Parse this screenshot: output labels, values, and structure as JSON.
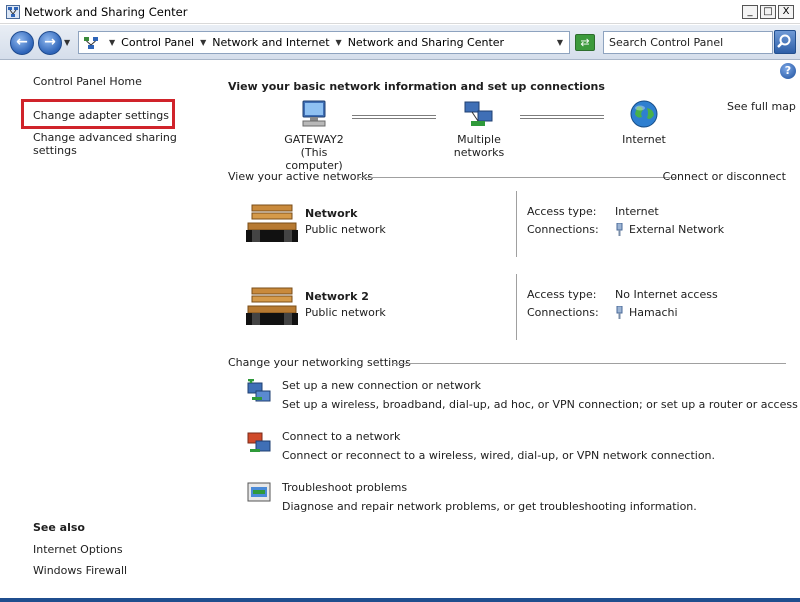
{
  "window": {
    "title": "Network and Sharing Center",
    "buttons": {
      "minimize": "_",
      "maximize": "□",
      "close": "X"
    }
  },
  "addressbar": {
    "crumbs": [
      "Control Panel",
      "Network and Internet",
      "Network and Sharing Center"
    ],
    "search_placeholder": "Search Control Panel"
  },
  "sidebar": {
    "home": "Control Panel Home",
    "links": [
      "Change adapter settings",
      "Change advanced sharing settings"
    ],
    "highlighted_link": "Change adapter settings",
    "highlight_color": "#d0232a",
    "see_also_heading": "See also",
    "see_also": [
      "Internet Options",
      "Windows Firewall"
    ]
  },
  "main": {
    "heading": "View your basic network information and set up connections",
    "see_full_map": "See full map",
    "map": {
      "computer_name": "GATEWAY2",
      "computer_sub": "(This computer)",
      "middle": "Multiple networks",
      "internet": "Internet"
    },
    "active_section": {
      "title": "View your active networks",
      "action": "Connect or disconnect"
    },
    "networks": [
      {
        "name": "Network",
        "category": "Public network",
        "access_label": "Access type:",
        "access_value": "Internet",
        "conn_label": "Connections:",
        "conn_value": "External Network"
      },
      {
        "name": "Network  2",
        "category": "Public network",
        "access_label": "Access type:",
        "access_value": "No Internet access",
        "conn_label": "Connections:",
        "conn_value": "Hamachi"
      }
    ],
    "change_section": {
      "title": "Change your networking settings"
    },
    "tasks": [
      {
        "icon": "new-connection-icon",
        "title": "Set up a new connection or network",
        "desc": "Set up a wireless, broadband, dial-up, ad hoc, or VPN connection; or set up a router or access point."
      },
      {
        "icon": "connect-network-icon",
        "title": "Connect to a network",
        "desc": "Connect or reconnect to a wireless, wired, dial-up, or VPN network connection."
      },
      {
        "icon": "troubleshoot-icon",
        "title": "Troubleshoot problems",
        "desc": "Diagnose and repair network problems, or get troubleshooting information."
      }
    ]
  },
  "colors": {
    "accent": "#2e64b8",
    "refresh": "#3c9a3c",
    "frame": "#1f4e8e"
  }
}
